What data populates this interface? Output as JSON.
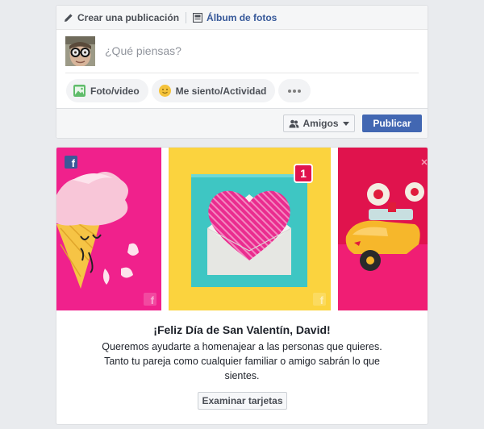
{
  "composer": {
    "tabs": [
      {
        "label": "Crear una publicación",
        "icon": "pencil-icon"
      },
      {
        "label": "Álbum de fotos",
        "icon": "photo-album-icon"
      }
    ],
    "placeholder": "¿Qué piensas?",
    "actions": [
      {
        "label": "Foto/video",
        "icon": "photo-icon",
        "color": "#5fbc6a"
      },
      {
        "label": "Me siento/Actividad",
        "icon": "smiley-icon",
        "color": "#f5c33b"
      },
      {
        "label": "",
        "icon": "more-dots-icon"
      }
    ],
    "audience_label": "Amigos",
    "publish_label": "Publicar"
  },
  "valentine": {
    "notification_count": "1",
    "title": "¡Feliz Día de San Valentín, David!",
    "text": "Queremos ayudarte a homenajear a las personas que quieres. Tanto tu pareja como cualquier familiar o amigo sabrán lo que sientes.",
    "button_label": "Examinar tarjetas",
    "badge_letter": "f"
  },
  "colors": {
    "brand": "#4267b2",
    "link": "#365899",
    "panel_pink": "#f0218c",
    "panel_yellow": "#fbd33e",
    "panel_red": "#e0134d"
  }
}
